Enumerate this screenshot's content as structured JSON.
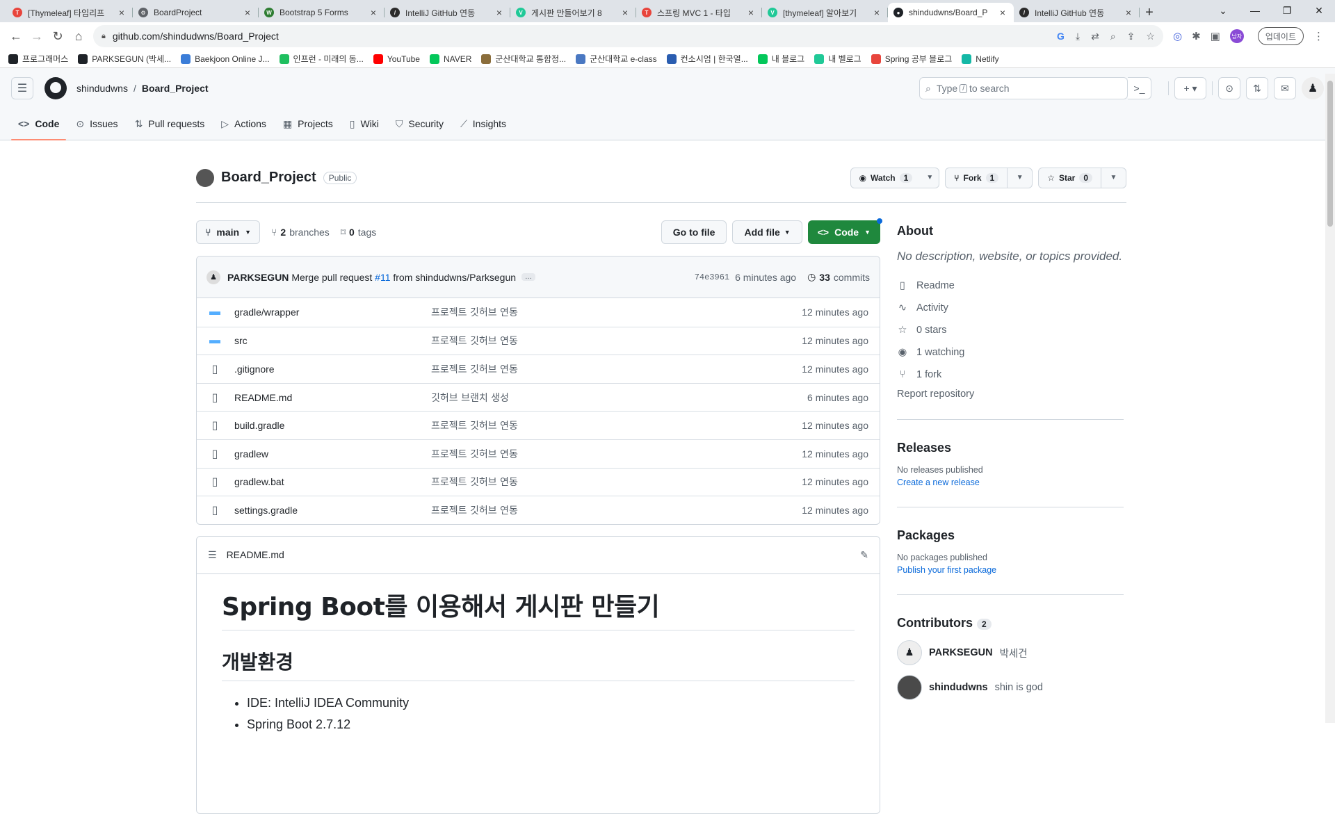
{
  "browser": {
    "tabs": [
      {
        "title": "[Thymeleaf] 타임리프 ",
        "color": "#e8453c",
        "glyph": "T"
      },
      {
        "title": "BoardProject",
        "color": "#5f6368",
        "glyph": "⚙"
      },
      {
        "title": "Bootstrap 5 Forms",
        "color": "#2e7d32",
        "glyph": "W"
      },
      {
        "title": "IntelliJ GitHub 연동",
        "color": "#2b2b2b",
        "glyph": "/"
      },
      {
        "title": "게시판 만들어보기 8",
        "color": "#20c997",
        "glyph": "V"
      },
      {
        "title": "스프링 MVC 1 - 타입",
        "color": "#e8453c",
        "glyph": "T"
      },
      {
        "title": "[thymeleaf] 알아보기",
        "color": "#20c997",
        "glyph": "V"
      },
      {
        "title": "shindudwns/Board_P",
        "color": "#1f2328",
        "glyph": "●"
      },
      {
        "title": "IntelliJ GitHub 연동",
        "color": "#2b2b2b",
        "glyph": "/"
      }
    ],
    "active_tab": 7,
    "url": "github.com/shindudwns/Board_Project",
    "update_label": "업데이트",
    "profile_label": "남자",
    "bookmarks": [
      {
        "label": "프로그래머스",
        "color": "#1f2328"
      },
      {
        "label": "PARKSEGUN (박세...",
        "color": "#1f2328"
      },
      {
        "label": "Baekjoon Online J...",
        "color": "#3b7dd8"
      },
      {
        "label": "인프런 - 미래의 동...",
        "color": "#1fbf5f"
      },
      {
        "label": "YouTube",
        "color": "#ff0000"
      },
      {
        "label": "NAVER",
        "color": "#03c75a"
      },
      {
        "label": "군산대학교 통합정...",
        "color": "#8a6d3b"
      },
      {
        "label": "군산대학교 e-class",
        "color": "#4a78c2"
      },
      {
        "label": "컨소시엄 | 한국열...",
        "color": "#2a5db0"
      },
      {
        "label": "내 블로그",
        "color": "#03c75a"
      },
      {
        "label": "내 벨로그",
        "color": "#20c997"
      },
      {
        "label": "Spring 공부 블로그",
        "color": "#e8453c"
      },
      {
        "label": "Netlify",
        "color": "#14b8a6"
      }
    ]
  },
  "header": {
    "owner": "shindudwns",
    "separator": "/",
    "repo": "Board_Project",
    "search_placeholder_pre": "Type",
    "search_key": "/",
    "search_placeholder_post": "to search"
  },
  "repo_nav": [
    {
      "label": "Code",
      "icon": "code-icon",
      "glyph": "<>"
    },
    {
      "label": "Issues",
      "icon": "issue-icon",
      "glyph": "⊙"
    },
    {
      "label": "Pull requests",
      "icon": "pull-request-icon",
      "glyph": "⇅"
    },
    {
      "label": "Actions",
      "icon": "play-icon",
      "glyph": "▷"
    },
    {
      "label": "Projects",
      "icon": "table-icon",
      "glyph": "▦"
    },
    {
      "label": "Wiki",
      "icon": "book-icon",
      "glyph": "▯"
    },
    {
      "label": "Security",
      "icon": "shield-icon",
      "glyph": "⛉"
    },
    {
      "label": "Insights",
      "icon": "graph-icon",
      "glyph": "⟋"
    }
  ],
  "repo": {
    "title": "Board_Project",
    "visibility": "Public",
    "watch": {
      "label": "Watch",
      "count": "1"
    },
    "fork": {
      "label": "Fork",
      "count": "1"
    },
    "star": {
      "label": "Star",
      "count": "0"
    }
  },
  "toolbar": {
    "branch": "main",
    "branches_count": "2",
    "branches_label": "branches",
    "tags_count": "0",
    "tags_label": "tags",
    "go_to_file": "Go to file",
    "add_file": "Add file",
    "code": "Code"
  },
  "commit": {
    "author": "PARKSEGUN",
    "message_pre": "Merge pull request",
    "pr": "#11",
    "message_post": "from shindudwns/Parksegun",
    "ellipsis": "…",
    "sha": "74e3961",
    "time": "6 minutes ago",
    "commits_count": "33",
    "commits_label": "commits"
  },
  "files": [
    {
      "name": "gradle/wrapper",
      "type": "dir",
      "message": "프로젝트 깃허브 연동",
      "time": "12 minutes ago"
    },
    {
      "name": "src",
      "type": "dir",
      "message": "프로젝트 깃허브 연동",
      "time": "12 minutes ago"
    },
    {
      "name": ".gitignore",
      "type": "file",
      "message": "프로젝트 깃허브 연동",
      "time": "12 minutes ago"
    },
    {
      "name": "README.md",
      "type": "file",
      "message": "깃허브 브랜치 생성",
      "time": "6 minutes ago"
    },
    {
      "name": "build.gradle",
      "type": "file",
      "message": "프로젝트 깃허브 연동",
      "time": "12 minutes ago"
    },
    {
      "name": "gradlew",
      "type": "file",
      "message": "프로젝트 깃허브 연동",
      "time": "12 minutes ago"
    },
    {
      "name": "gradlew.bat",
      "type": "file",
      "message": "프로젝트 깃허브 연동",
      "time": "12 minutes ago"
    },
    {
      "name": "settings.gradle",
      "type": "file",
      "message": "프로젝트 깃허브 연동",
      "time": "12 minutes ago"
    }
  ],
  "readme": {
    "filename": "README.md",
    "h1": "Spring Boot를 이용해서 게시판 만들기",
    "h2": "개발환경",
    "items": [
      "IDE: IntelliJ IDEA Community",
      "Spring Boot 2.7.12"
    ]
  },
  "about": {
    "heading": "About",
    "description": "No description, website, or topics provided.",
    "items": [
      {
        "label": "Readme",
        "icon": "book-icon",
        "glyph": "▯"
      },
      {
        "label": "Activity",
        "icon": "pulse-icon",
        "glyph": "∿"
      },
      {
        "label": "0 stars",
        "icon": "star-icon",
        "glyph": "☆"
      },
      {
        "label": "1 watching",
        "icon": "eye-icon",
        "glyph": "◉"
      },
      {
        "label": "1 fork",
        "icon": "fork-icon",
        "glyph": "⑂"
      }
    ],
    "report": "Report repository"
  },
  "releases": {
    "heading": "Releases",
    "none": "No releases published",
    "link": "Create a new release"
  },
  "packages": {
    "heading": "Packages",
    "none": "No packages published",
    "link": "Publish your first package"
  },
  "contributors": {
    "heading": "Contributors",
    "count": "2",
    "list": [
      {
        "login": "PARKSEGUN",
        "name": "박세건"
      },
      {
        "login": "shindudwns",
        "name": "shin is god"
      }
    ]
  }
}
